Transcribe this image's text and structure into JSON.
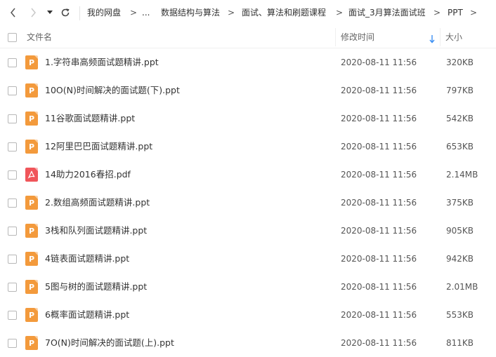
{
  "breadcrumb": {
    "items": [
      "我的网盘",
      "...",
      "数据结构与算法",
      "面试、算法和刷题课程",
      "面试_3月算法面试班",
      "PPT"
    ],
    "separator": ">"
  },
  "header": {
    "name_label": "文件名",
    "modified_label": "修改时间",
    "size_label": "大小"
  },
  "colors": {
    "ppt_icon": "#f39a3c",
    "pdf_icon": "#f0555a",
    "sort_arrow": "#3b8ff3"
  },
  "files": [
    {
      "name": "1.字符串高频面试题精讲.ppt",
      "modified": "2020-08-11 11:56",
      "size": "320KB",
      "icon": "ppt-icon"
    },
    {
      "name": "10O(N)时间解决的面试题(下).ppt",
      "modified": "2020-08-11 11:56",
      "size": "797KB",
      "icon": "ppt-icon"
    },
    {
      "name": "11谷歌面试题精讲.ppt",
      "modified": "2020-08-11 11:56",
      "size": "542KB",
      "icon": "ppt-icon"
    },
    {
      "name": "12阿里巴巴面试题精讲.ppt",
      "modified": "2020-08-11 11:56",
      "size": "653KB",
      "icon": "ppt-icon"
    },
    {
      "name": "14助力2016春招.pdf",
      "modified": "2020-08-11 11:56",
      "size": "2.14MB",
      "icon": "pdf-icon"
    },
    {
      "name": "2.数组高频面试题精讲.ppt",
      "modified": "2020-08-11 11:56",
      "size": "375KB",
      "icon": "ppt-icon"
    },
    {
      "name": "3栈和队列面试题精讲.ppt",
      "modified": "2020-08-11 11:56",
      "size": "905KB",
      "icon": "ppt-icon"
    },
    {
      "name": "4链表面试题精讲.ppt",
      "modified": "2020-08-11 11:56",
      "size": "942KB",
      "icon": "ppt-icon"
    },
    {
      "name": "5图与树的面试题精讲.ppt",
      "modified": "2020-08-11 11:56",
      "size": "2.01MB",
      "icon": "ppt-icon"
    },
    {
      "name": "6概率面试题精讲.ppt",
      "modified": "2020-08-11 11:56",
      "size": "553KB",
      "icon": "ppt-icon"
    },
    {
      "name": "7O(N)时间解决的面试题(上).ppt",
      "modified": "2020-08-11 11:56",
      "size": "811KB",
      "icon": "ppt-icon"
    }
  ]
}
